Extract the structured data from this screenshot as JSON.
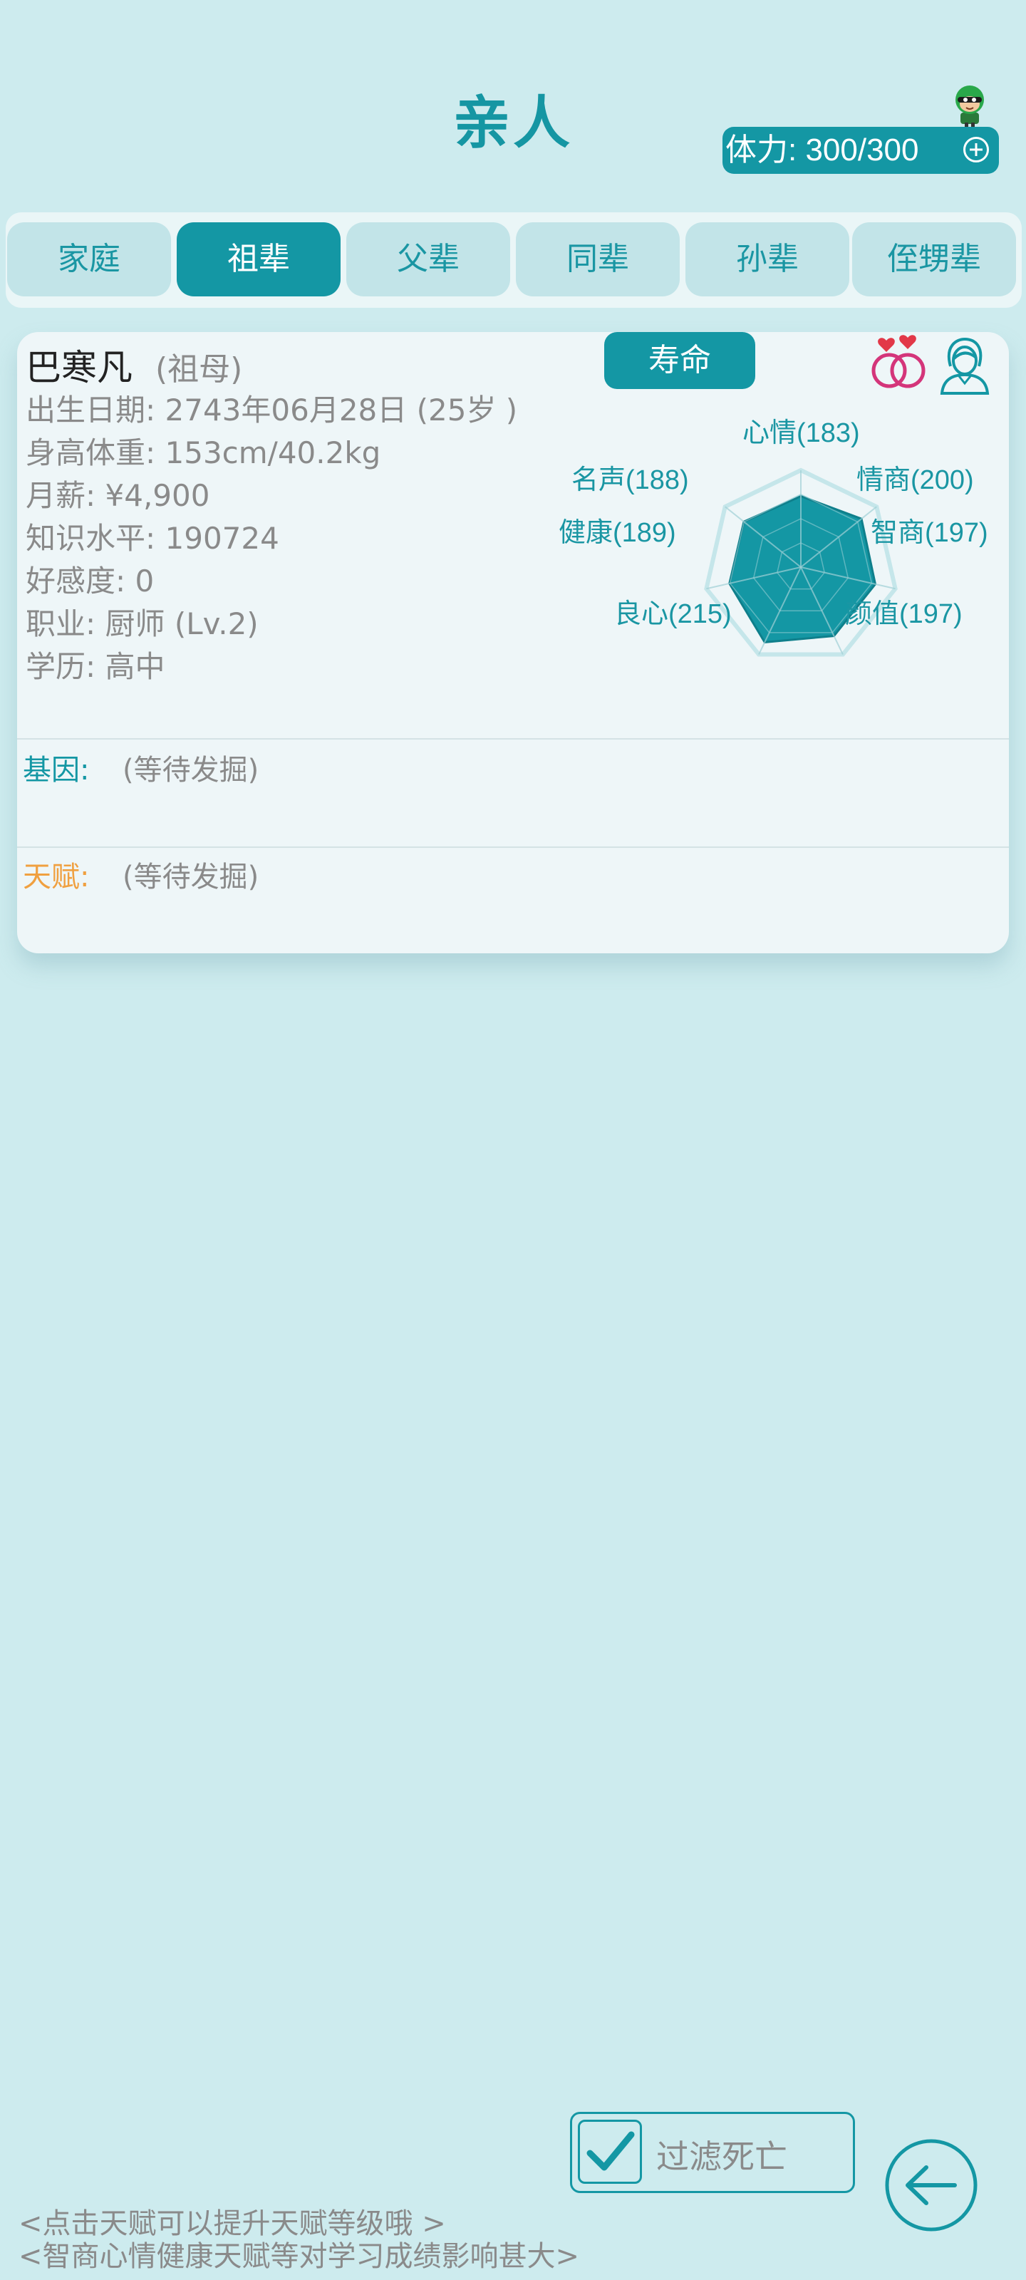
{
  "header": {
    "title": "亲人",
    "stamina_label": "体力: 300/300",
    "icons": [
      "player-avatar-icon",
      "plus-circle-icon"
    ]
  },
  "tabs": [
    {
      "label": "家庭",
      "active": false
    },
    {
      "label": "祖辈",
      "active": true
    },
    {
      "label": "父辈",
      "active": false
    },
    {
      "label": "同辈",
      "active": false
    },
    {
      "label": "孙辈",
      "active": false
    },
    {
      "label": "侄甥辈",
      "active": false
    }
  ],
  "card": {
    "name": "巴寒凡",
    "relation": "(祖母)",
    "lifespan_button": "寿命",
    "icons": [
      "wedding-rings-icon",
      "woman-portrait-icon"
    ],
    "info": [
      "出生日期: 2743年06月28日 (25岁 )",
      "身高体重: 153cm/40.2kg",
      "月薪: ¥4,900",
      "知识水平: 190724",
      "好感度: 0",
      "职业: 厨师 (Lv.2)",
      "学历: 高中"
    ],
    "genes_label": "基因:",
    "genes_value": "(等待发掘)",
    "talent_label": "天赋:",
    "talent_value": "(等待发掘)"
  },
  "chart_data": {
    "type": "radar",
    "max": 250,
    "axes": [
      {
        "name": "心情",
        "value": 183,
        "label": "心情(183)"
      },
      {
        "name": "情商",
        "value": 200,
        "label": "情商(200)"
      },
      {
        "name": "智商",
        "value": 197,
        "label": "智商(197)"
      },
      {
        "name": "颜值",
        "value": 197,
        "label": "颜值(197)"
      },
      {
        "name": "良心",
        "value": 215,
        "label": "良心(215)"
      },
      {
        "name": "健康",
        "value": 189,
        "label": "健康(189)"
      },
      {
        "name": "名声",
        "value": 188,
        "label": "名声(188)"
      }
    ],
    "fill_color": "#1497a4",
    "grid_color": "#c5e6ea"
  },
  "footer": {
    "filter_label": "过滤死亡",
    "filter_checked": true,
    "tip1": "<点击天赋可以提升天赋等级哦 >",
    "tip2": "<智商心情健康天赋等对学习成绩影响甚大>",
    "icons": [
      "checkmark-icon",
      "back-arrow-icon"
    ]
  },
  "colors": {
    "background": "#cdebee",
    "accent": "#1497a4",
    "talent": "#f0a040"
  }
}
